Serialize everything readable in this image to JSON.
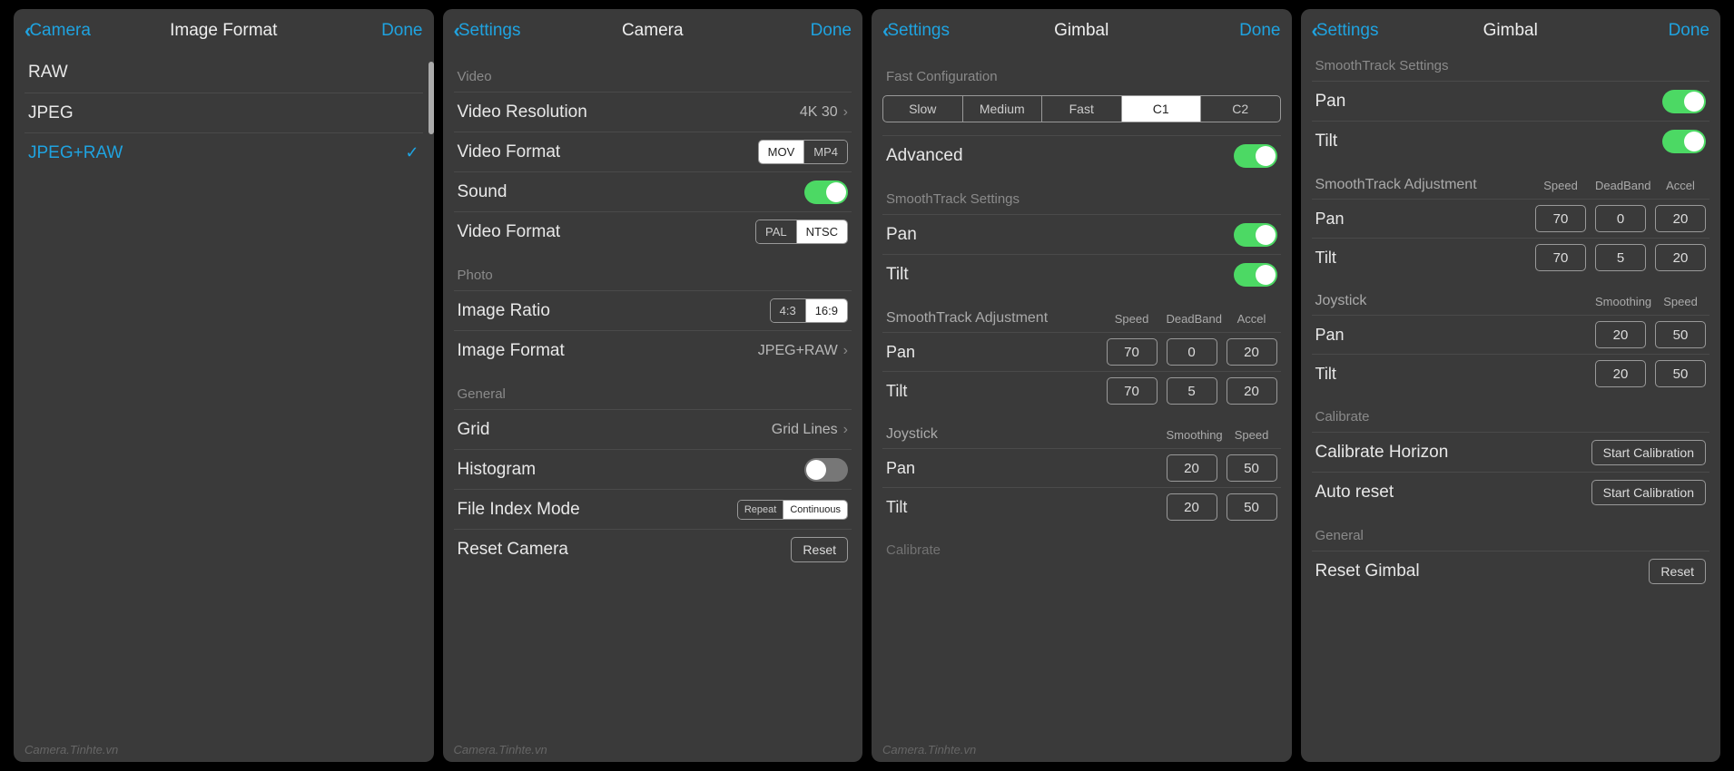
{
  "common": {
    "done": "Done",
    "watermark": "Camera.Tinhte.vn"
  },
  "panel1": {
    "back": "Camera",
    "title": "Image Format",
    "options": [
      "RAW",
      "JPEG",
      "JPEG+RAW"
    ],
    "selected_index": 2
  },
  "panel2": {
    "back": "Settings",
    "title": "Camera",
    "sections": {
      "video": "Video",
      "photo": "Photo",
      "general": "General"
    },
    "rows": {
      "video_resolution": {
        "label": "Video Resolution",
        "value": "4K 30"
      },
      "video_format1": {
        "label": "Video Format",
        "options": [
          "MOV",
          "MP4"
        ],
        "active": 0
      },
      "sound": {
        "label": "Sound",
        "on": true
      },
      "video_format2": {
        "label": "Video Format",
        "options": [
          "PAL",
          "NTSC"
        ],
        "active": 1
      },
      "image_ratio": {
        "label": "Image Ratio",
        "options": [
          "4:3",
          "16:9"
        ],
        "active": 1
      },
      "image_format": {
        "label": "Image Format",
        "value": "JPEG+RAW"
      },
      "grid": {
        "label": "Grid",
        "value": "Grid Lines"
      },
      "histogram": {
        "label": "Histogram",
        "on": false
      },
      "file_index": {
        "label": "File Index Mode",
        "options": [
          "Repeat",
          "Continuous"
        ],
        "active": 1
      },
      "reset": {
        "label": "Reset Camera",
        "button": "Reset"
      }
    }
  },
  "panel3": {
    "back": "Settings",
    "title": "Gimbal",
    "fast_conf": {
      "label": "Fast Configuration",
      "options": [
        "Slow",
        "Medium",
        "Fast",
        "C1",
        "C2"
      ],
      "active": 3
    },
    "advanced": {
      "label": "Advanced",
      "on": true
    },
    "smoothtrack_settings": {
      "label": "SmoothTrack Settings",
      "pan": "Pan",
      "tilt": "Tilt",
      "pan_on": true,
      "tilt_on": true
    },
    "smoothtrack_adjust": {
      "label": "SmoothTrack Adjustment",
      "cols": [
        "Speed",
        "DeadBand",
        "Accel"
      ],
      "pan": {
        "label": "Pan",
        "vals": [
          "70",
          "0",
          "20"
        ]
      },
      "tilt": {
        "label": "Tilt",
        "vals": [
          "70",
          "5",
          "20"
        ]
      }
    },
    "joystick": {
      "label": "Joystick",
      "cols": [
        "Smoothing",
        "Speed"
      ],
      "pan": {
        "label": "Pan",
        "vals": [
          "20",
          "50"
        ]
      },
      "tilt": {
        "label": "Tilt",
        "vals": [
          "20",
          "50"
        ]
      }
    },
    "calibrate_label": "Calibrate"
  },
  "panel4": {
    "back": "Settings",
    "title": "Gimbal",
    "smoothtrack_settings": {
      "label": "SmoothTrack Settings",
      "pan": "Pan",
      "tilt": "Tilt",
      "pan_on": true,
      "tilt_on": true
    },
    "smoothtrack_adjust": {
      "label": "SmoothTrack Adjustment",
      "cols": [
        "Speed",
        "DeadBand",
        "Accel"
      ],
      "pan": {
        "label": "Pan",
        "vals": [
          "70",
          "0",
          "20"
        ]
      },
      "tilt": {
        "label": "Tilt",
        "vals": [
          "70",
          "5",
          "20"
        ]
      }
    },
    "joystick": {
      "label": "Joystick",
      "cols": [
        "Smoothing",
        "Speed"
      ],
      "pan": {
        "label": "Pan",
        "vals": [
          "20",
          "50"
        ]
      },
      "tilt": {
        "label": "Tilt",
        "vals": [
          "20",
          "50"
        ]
      }
    },
    "calibrate": {
      "label": "Calibrate",
      "horizon": {
        "label": "Calibrate Horizon",
        "button": "Start Calibration"
      },
      "auto_reset": {
        "label": "Auto reset",
        "button": "Start Calibration"
      }
    },
    "general": {
      "label": "General",
      "reset": {
        "label": "Reset Gimbal",
        "button": "Reset"
      }
    }
  }
}
